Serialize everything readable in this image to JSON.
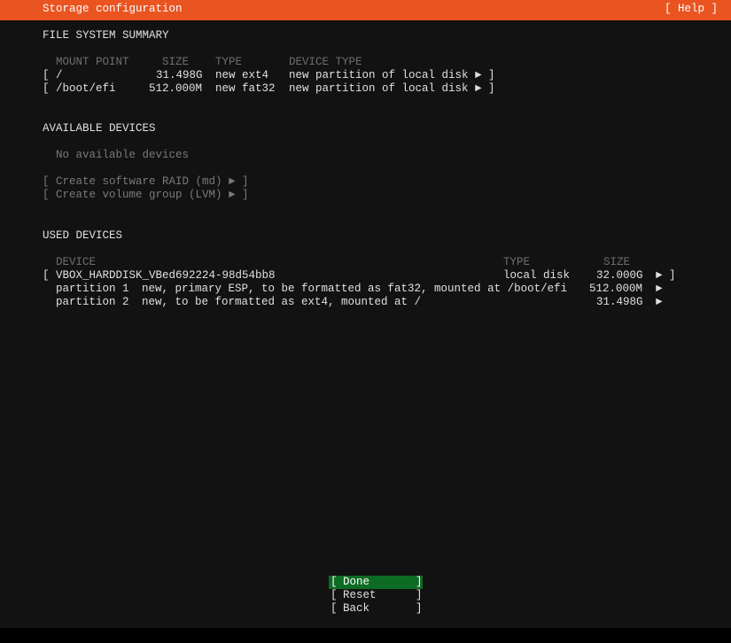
{
  "header": {
    "title": "Storage configuration",
    "help": "[ Help ]"
  },
  "fs_summary": {
    "heading": "FILE SYSTEM SUMMARY",
    "columns": [
      "MOUNT POINT",
      "SIZE",
      "TYPE",
      "DEVICE TYPE"
    ],
    "rows": [
      {
        "mount": "/",
        "size": "31.498G",
        "type": "new ext4",
        "device_type": "new partition of local disk"
      },
      {
        "mount": "/boot/efi",
        "size": "512.000M",
        "type": "new fat32",
        "device_type": "new partition of local disk"
      }
    ]
  },
  "available": {
    "heading": "AVAILABLE DEVICES",
    "empty": "No available devices",
    "raid": "Create software RAID (md)",
    "lvm": "Create volume group (LVM)"
  },
  "used": {
    "heading": "USED DEVICES",
    "columns": [
      "DEVICE",
      "TYPE",
      "SIZE"
    ],
    "disk": {
      "name": "VBOX_HARDDISK_VBed692224-98d54bb8",
      "type": "local disk",
      "size": "32.000G"
    },
    "partitions": [
      {
        "name": "partition 1",
        "desc": "new, primary ESP, to be formatted as fat32, mounted at /boot/efi",
        "size": "512.000M"
      },
      {
        "name": "partition 2",
        "desc": "new, to be formatted as ext4, mounted at /",
        "size": "31.498G"
      }
    ]
  },
  "buttons": {
    "done": "Done",
    "reset": "Reset",
    "back": "Back"
  },
  "symbols": {
    "arrow": "►",
    "lb": "[",
    "rb": "]"
  }
}
